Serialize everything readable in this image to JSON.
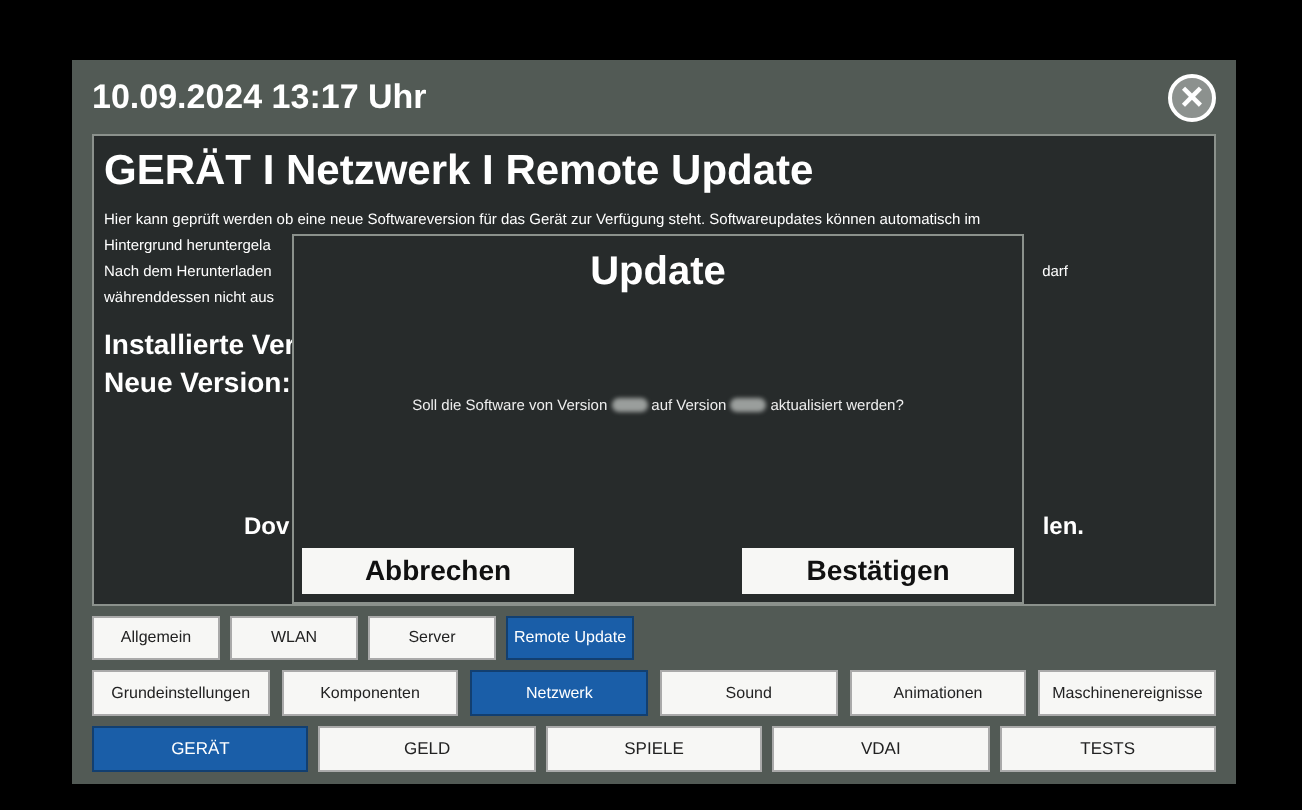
{
  "header": {
    "datetime": "10.09.2024 13:17 Uhr",
    "close": "×"
  },
  "page": {
    "title": "GERÄT I Netzwerk I Remote Update",
    "lines": [
      {
        "left": "Hier kann geprüft werden ob eine neue Softwareversion für das Gerät zur Verfügung steht. Softwareupdates können automatisch im"
      },
      {
        "left": "Hintergrund heruntergela"
      },
      {
        "left": "Nach dem Herunterladen",
        "right": "darf"
      },
      {
        "left": "währenddessen nicht aus"
      }
    ],
    "installed_label": "Installierte Ver",
    "new_label": "Neue Version:",
    "download_left": "Dov",
    "download_right": "len."
  },
  "dialog": {
    "title": "Update",
    "message_start": "Soll die Software von Version",
    "message_middle": "auf Version",
    "message_end": "aktualisiert werden?",
    "buttons": [
      "Abbrechen",
      "Bestätigen"
    ]
  },
  "subtabs": [
    {
      "label": "Allgemein",
      "selected": false
    },
    {
      "label": "WLAN",
      "selected": false
    },
    {
      "label": "Server",
      "selected": false
    },
    {
      "label": "Remote Update",
      "selected": true
    }
  ],
  "categories": [
    {
      "label": "Grundeinstellungen",
      "selected": false
    },
    {
      "label": "Komponenten",
      "selected": false
    },
    {
      "label": "Netzwerk",
      "selected": true
    },
    {
      "label": "Sound",
      "selected": false
    },
    {
      "label": "Animationen",
      "selected": false
    },
    {
      "label": "Maschinenereignisse",
      "selected": false
    }
  ],
  "sections": [
    {
      "label": "GERÄT",
      "selected": true
    },
    {
      "label": "GELD",
      "selected": false
    },
    {
      "label": "SPIELE",
      "selected": false
    },
    {
      "label": "VDAI",
      "selected": false
    },
    {
      "label": "TESTS",
      "selected": false
    }
  ]
}
